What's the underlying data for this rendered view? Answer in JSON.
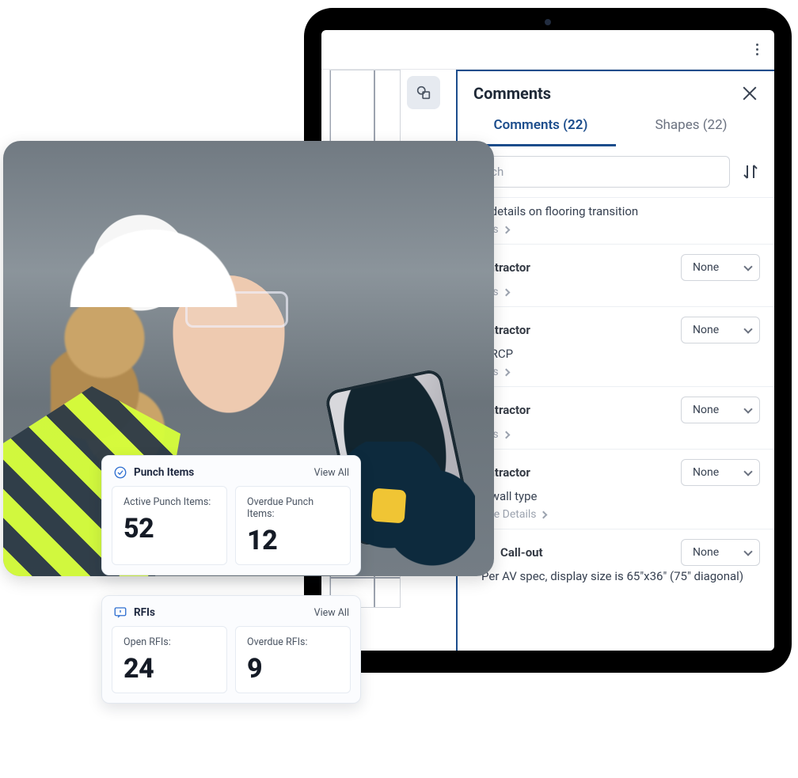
{
  "tablet": {
    "panel": {
      "title": "Comments",
      "close_name": "close",
      "tabs": {
        "comments": "Comments (22)",
        "shapes": "Shapes (22)"
      },
      "search_placeholder": "Search",
      "search_visible_text": "arch",
      "comments": [
        {
          "author": "",
          "body": "e details on flooring transition",
          "details": "ails",
          "dropdown": ""
        },
        {
          "author": "ontractor",
          "body": "",
          "details": "ails",
          "dropdown": "None"
        },
        {
          "author": "ontractor",
          "body": "e RCP",
          "details": "ails",
          "dropdown": "None"
        },
        {
          "author": "ontractor",
          "body": "",
          "details": "ails",
          "dropdown": "None"
        },
        {
          "author": "ontractor",
          "body": "e wall type",
          "details": "See Details",
          "dropdown": "None"
        },
        {
          "author": "Call-out",
          "body": "Per AV spec, display size is 65\"x36\" (75\" diagonal)",
          "details": "",
          "dropdown": "None",
          "is_callout": true
        }
      ]
    }
  },
  "widgets": {
    "punch": {
      "title": "Punch Items",
      "view_all": "View All",
      "boxes": [
        {
          "label": "Active Punch Items:",
          "value": "52"
        },
        {
          "label": "Overdue Punch Items:",
          "value": "12"
        }
      ]
    },
    "rfis": {
      "title": "RFIs",
      "view_all": "View All",
      "boxes": [
        {
          "label": "Open RFIs:",
          "value": "24"
        },
        {
          "label": "Overdue RFIs:",
          "value": "9"
        }
      ]
    }
  }
}
